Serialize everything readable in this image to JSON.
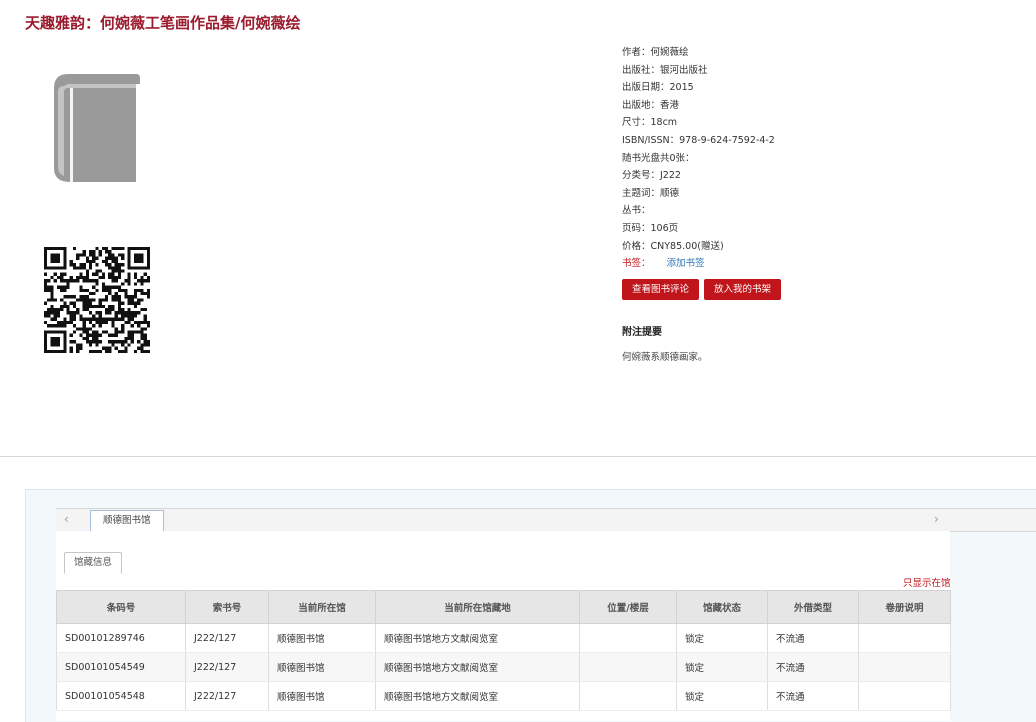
{
  "title": "天趣雅韵：何婉薇工笔画作品集/何婉薇绘",
  "meta": {
    "author": "作者：何婉薇绘",
    "publisher": "出版社：银河出版社",
    "pub_date": "出版日期：2015",
    "pub_place": "出版地：香港",
    "size": "尺寸：18cm",
    "isbn": "ISBN/ISSN：978-9-624-7592-4-2",
    "disc": "随书光盘共0张：",
    "class_no": "分类号：J222",
    "subject": "主题词：顺德",
    "series": "丛书：",
    "pages": "页码：106页",
    "price": "价格：CNY85.00(赠送)",
    "bookmark_label": "书签：",
    "bookmark_link": "添加书签"
  },
  "buttons": {
    "review": "查看图书评论",
    "shelf": "放入我的书架"
  },
  "remarks": {
    "title": "附注提要",
    "text": "何婉薇系顺德画家。"
  },
  "holdings": {
    "tab_prev": "‹",
    "tab_next": "›",
    "library_tab": "顺德图书馆",
    "subtab": "馆藏信息",
    "filter_link": "只显示在馆",
    "columns": [
      "条码号",
      "索书号",
      "当前所在馆",
      "当前所在馆藏地",
      "位置/楼层",
      "馆藏状态",
      "外借类型",
      "卷册说明"
    ],
    "rows": [
      [
        "SD00101289746",
        "J222/127",
        "顺德图书馆",
        "顺德图书馆地方文献阅览室",
        "",
        "锁定",
        "不流通",
        ""
      ],
      [
        "SD00101054549",
        "J222/127",
        "顺德图书馆",
        "顺德图书馆地方文献阅览室",
        "",
        "锁定",
        "不流通",
        ""
      ],
      [
        "SD00101054548",
        "J222/127",
        "顺德图书馆",
        "顺德图书馆地方文献阅览室",
        "",
        "锁定",
        "不流通",
        ""
      ]
    ]
  },
  "colors": {
    "title": "#9b1c2e",
    "accent": "#c0151b",
    "link": "#2e74b5"
  },
  "icons": {
    "cover": "book-icon",
    "qr": "qr-code-icon"
  }
}
